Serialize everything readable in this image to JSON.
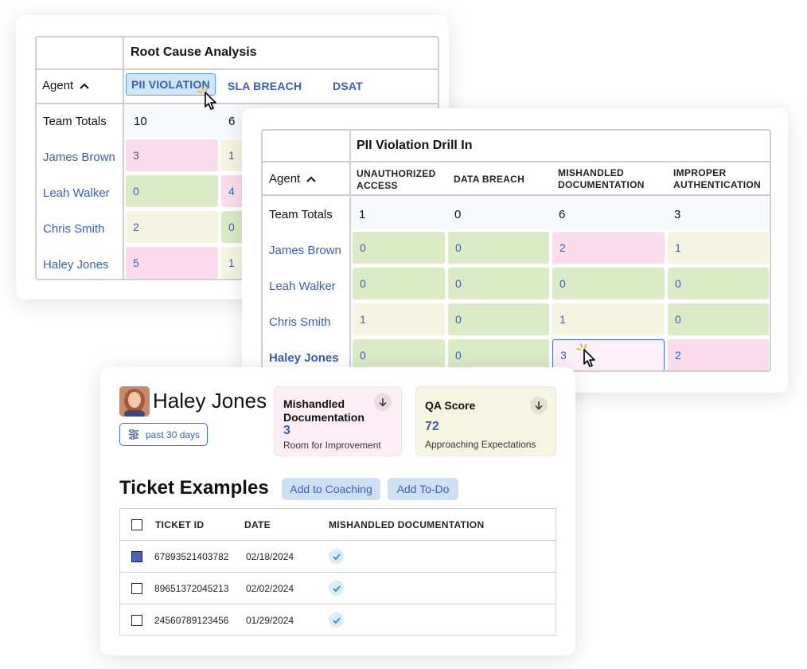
{
  "root_cause": {
    "title": "Root Cause Analysis",
    "agent_header": "Agent",
    "tabs": [
      "PII VIOLATION",
      "SLA BREACH",
      "DSAT"
    ],
    "totals_label": "Team Totals",
    "totals": [
      "10",
      "6"
    ],
    "rows": [
      {
        "agent": "James Brown",
        "values": [
          "3",
          "1"
        ]
      },
      {
        "agent": "Leah Walker",
        "values": [
          "0",
          "4"
        ]
      },
      {
        "agent": "Chris Smith",
        "values": [
          "2",
          "0"
        ]
      },
      {
        "agent": "Haley Jones",
        "values": [
          "5",
          "1"
        ]
      }
    ]
  },
  "drill_in": {
    "title": "PII Violation Drill In",
    "agent_header": "Agent",
    "columns": [
      "UNAUTHORIZED ACCESS",
      "DATA BREACH",
      "MISHANDLED DOCUMENTATION",
      "IMPROPER AUTHENTICATION"
    ],
    "totals_label": "Team Totals",
    "totals": [
      "1",
      "0",
      "6",
      "3"
    ],
    "rows": [
      {
        "agent": "James Brown",
        "values": [
          "0",
          "0",
          "2",
          "1"
        ]
      },
      {
        "agent": "Leah Walker",
        "values": [
          "0",
          "0",
          "0",
          "0"
        ]
      },
      {
        "agent": "Chris Smith",
        "values": [
          "1",
          "0",
          "1",
          "0"
        ]
      },
      {
        "agent": "Haley Jones",
        "values": [
          "0",
          "0",
          "3",
          "2"
        ]
      }
    ]
  },
  "agent_detail": {
    "name": "Haley Jones",
    "period_button": "past 30 days",
    "metrics": [
      {
        "title": "Mishandled Documentation",
        "value": "3",
        "subtitle": "Room for Improvement",
        "color": "#fdeef5"
      },
      {
        "title": "QA Score",
        "value": "72",
        "subtitle": "Approaching Expectations",
        "color": "#f6f5e2"
      }
    ],
    "section_title": "Ticket Examples",
    "buttons": [
      "Add to Coaching",
      "Add To-Do"
    ],
    "table_headers": [
      "TICKET ID",
      "DATE",
      "MISHANDLED DOCUMENTATION"
    ],
    "tickets": [
      {
        "id": "67893521403782",
        "date": "02/18/2024",
        "checked": true
      },
      {
        "id": "89651372045213",
        "date": "02/02/2024",
        "checked": false
      },
      {
        "id": "24560789123456",
        "date": "01/29/2024",
        "checked": false
      }
    ]
  },
  "colors": {
    "link_blue": "#3a5fb0",
    "cell_pink": "#fbdcec",
    "cell_green": "#daebc6",
    "cell_cream": "#f5f4e1",
    "tab_active": "#cfe6f7"
  }
}
